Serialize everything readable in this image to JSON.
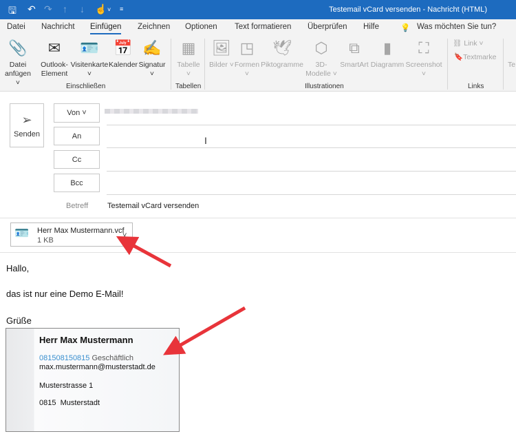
{
  "window": {
    "title": "Testemail vCard versenden  -  Nachricht (HTML)"
  },
  "quick_access": [
    "save-icon",
    "undo-icon",
    "redo-icon",
    "up-icon",
    "down-icon",
    "touch-mode-icon",
    "customize-icon"
  ],
  "tabs": [
    {
      "label": "Datei"
    },
    {
      "label": "Nachricht"
    },
    {
      "label": "Einfügen",
      "active": true
    },
    {
      "label": "Zeichnen"
    },
    {
      "label": "Optionen"
    },
    {
      "label": "Text formatieren"
    },
    {
      "label": "Überprüfen"
    },
    {
      "label": "Hilfe"
    }
  ],
  "tell_me": "Was möchten Sie tun?",
  "ribbon": {
    "groups": {
      "include": "Einschließen",
      "tables": "Tabellen",
      "illustrations": "Illustrationen",
      "links": "Links"
    },
    "buttons": {
      "attach": "Datei anfügen ˅",
      "outlook_item": "Outlook-Element",
      "business_card": "Visitenkarte ˅",
      "calendar": "Kalender",
      "signature": "Signatur ˅",
      "table": "Tabelle ˅",
      "pictures": "Bilder ˅",
      "shapes": "Formen ˅",
      "icons": "Piktogramme",
      "models": "3D-Modelle ˅",
      "smartart": "SmartArt",
      "chart": "Diagramm",
      "screenshot": "Screenshot ˅",
      "link": "Link ˅",
      "bookmark": "Textmarke",
      "text": "Te"
    }
  },
  "compose": {
    "send": "Senden",
    "from": "Von ˅",
    "to": "An",
    "cc": "Cc",
    "bcc": "Bcc",
    "subject_label": "Betreff",
    "subject": "Testemail vCard versenden"
  },
  "attachment": {
    "name": "Herr Max Mustermann.vcf",
    "size": "1 KB"
  },
  "body": {
    "greeting": "Hallo,",
    "line": "das ist nur eine Demo E-Mail!",
    "closing": "Grüße"
  },
  "card": {
    "name": "Herr Max Mustermann",
    "phone": "081508150815",
    "phone_type": "Geschäftlich",
    "email": "max.mustermann@musterstadt.de",
    "street": "Musterstrasse 1",
    "city": "0815  Musterstadt"
  },
  "colors": {
    "titlebar": "#1d6bbf",
    "link": "#3a8fcf",
    "arrow": "#e8343a"
  }
}
